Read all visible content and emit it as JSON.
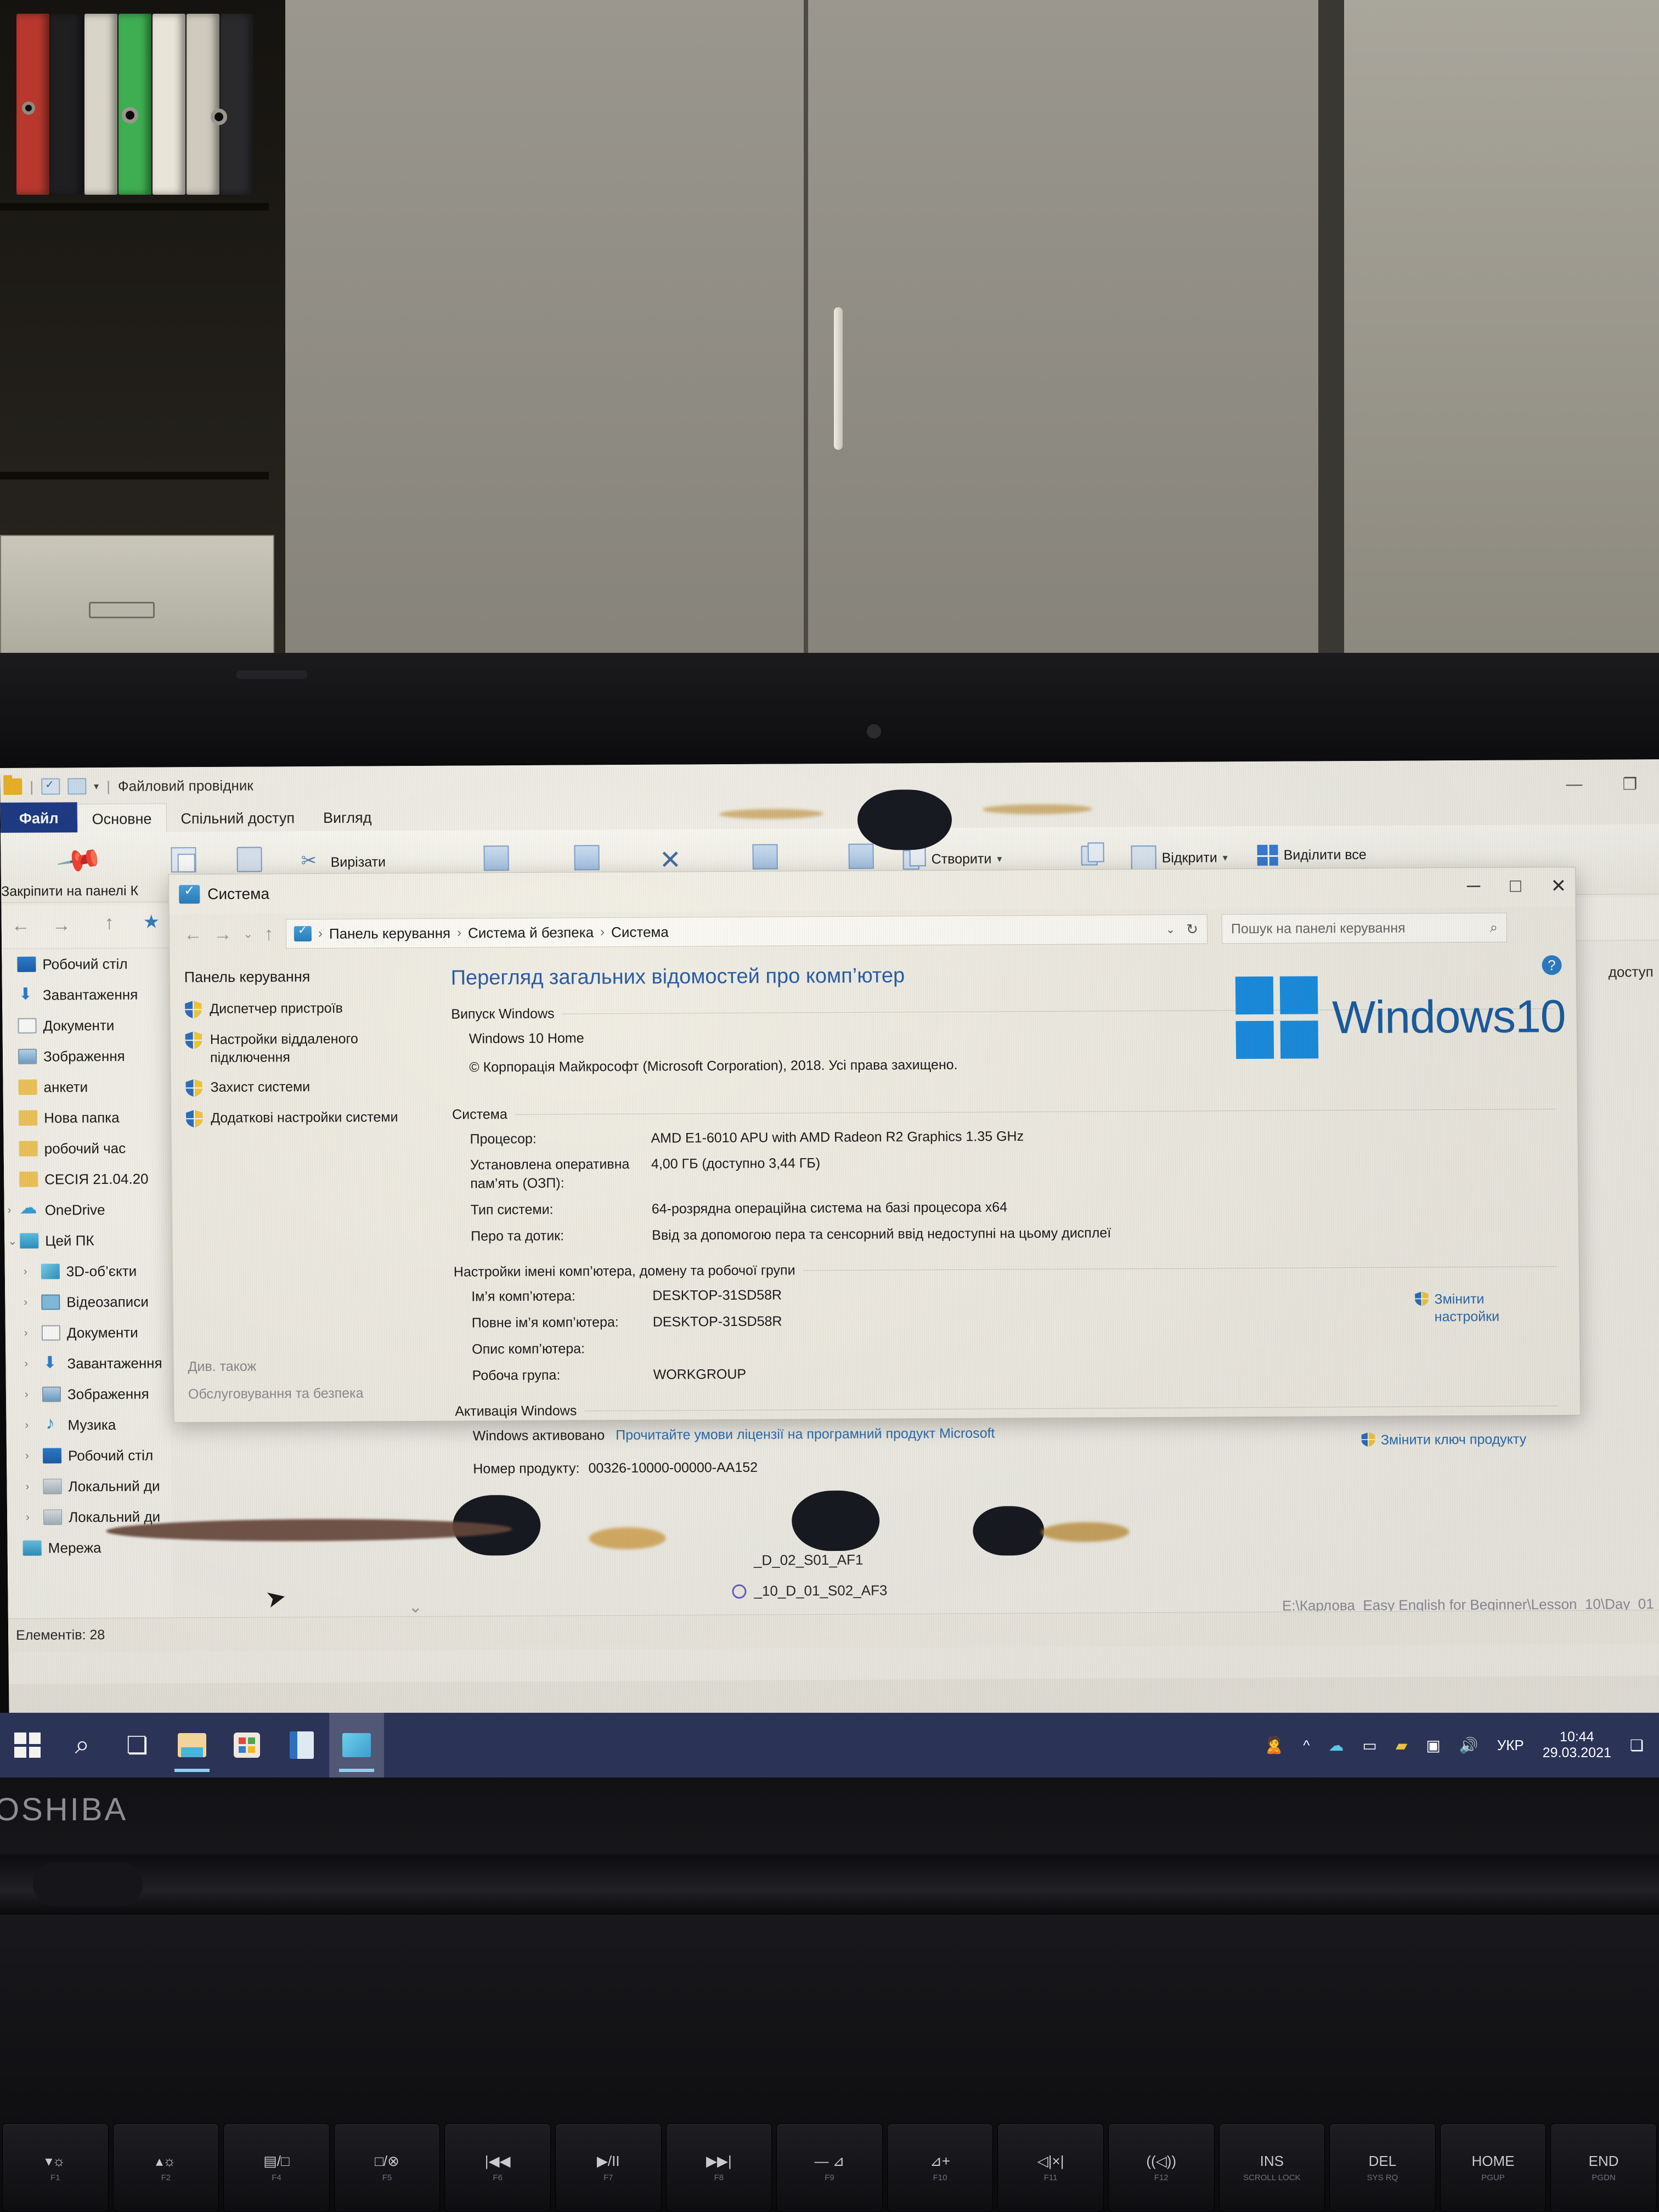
{
  "explorer": {
    "window_title": "Файловий провідник",
    "qat_icons": [
      "folder-icon",
      "properties-icon",
      "new-folder-icon",
      "dropdown-caret-icon"
    ],
    "tabs": [
      {
        "label": "Файл"
      },
      {
        "label": "Основне"
      },
      {
        "label": "Спільний доступ"
      },
      {
        "label": "Вигляд"
      }
    ],
    "ribbon": {
      "pin_label": "Закріпити на панелі К\nшвидкого доступу",
      "cut_label": "Вирізати",
      "new_label": "Створити",
      "open_label": "Відкрити",
      "select_all_label": "Виділити все"
    },
    "quick_access": [
      {
        "label": "Робочий стіл",
        "icon": "desktop-icon"
      },
      {
        "label": "Завантаження",
        "icon": "downloads-icon"
      },
      {
        "label": "Документи",
        "icon": "documents-icon"
      },
      {
        "label": "Зображення",
        "icon": "pictures-icon"
      },
      {
        "label": "анкети",
        "icon": "folder-icon"
      },
      {
        "label": "Нова папка",
        "icon": "folder-icon"
      },
      {
        "label": "робочий час",
        "icon": "folder-icon"
      },
      {
        "label": "СЕСІЯ 21.04.20",
        "icon": "folder-icon"
      }
    ],
    "onedrive": {
      "label": "OneDrive",
      "icon": "cloud-icon"
    },
    "this_pc": {
      "label": "Цей ПК",
      "icon": "pc-icon"
    },
    "this_pc_children": [
      {
        "label": "3D-об’єкти",
        "icon": "3d-objects-icon"
      },
      {
        "label": "Відеозаписи",
        "icon": "videos-icon"
      },
      {
        "label": "Документи",
        "icon": "documents-icon"
      },
      {
        "label": "Завантаження",
        "icon": "downloads-icon"
      },
      {
        "label": "Зображення",
        "icon": "pictures-icon"
      },
      {
        "label": "Музика",
        "icon": "music-icon"
      },
      {
        "label": "Робочий стіл",
        "icon": "desktop-icon"
      },
      {
        "label": "Локальний ди",
        "icon": "drive-icon"
      },
      {
        "label": "Локальний ди",
        "icon": "drive-icon"
      }
    ],
    "network": {
      "label": "Мережа",
      "icon": "network-icon"
    },
    "status": "Елементів: 28",
    "files": [
      {
        "name": "_D_02_S01_AF1"
      },
      {
        "name": "_10_D_01_S02_AF3"
      }
    ],
    "path_text": "E:\\Карлова_Easy English for Beginner\\Lesson_10\\Day_01",
    "right_panel_text": "доступ"
  },
  "system_window": {
    "title": "Система",
    "icon": "system-icon",
    "controls": {
      "minimize": "─",
      "maximize": "□",
      "close": "✕"
    },
    "breadcrumb": [
      "Панель керування",
      "Система й безпека",
      "Система"
    ],
    "search_placeholder": "Пошук на панелі керування",
    "search_icon": "search-icon",
    "refresh_icon": "refresh-icon",
    "help_icon": "help-icon",
    "left_panel": {
      "header": "Панель керування",
      "links": [
        {
          "label": "Диспетчер пристроїв",
          "icon": "shield-icon"
        },
        {
          "label": "Настройки віддаленого підключення",
          "icon": "shield-icon"
        },
        {
          "label": "Захист системи",
          "icon": "shield-icon"
        },
        {
          "label": "Додаткові настройки системи",
          "icon": "shield-icon"
        }
      ],
      "see_also_header": "Див. також",
      "see_also_link": "Обслуговування та безпека"
    },
    "page_title": "Перегляд загальних відомостей про комп’ютер",
    "groups": {
      "windows_edition": {
        "header": "Випуск Windows",
        "edition": "Windows 10 Home",
        "copyright": "© Корпорація Майкрософт (Microsoft Corporation), 2018. Усі права захищено.",
        "logo_text": "Windows",
        "logo_version": "10"
      },
      "system": {
        "header": "Система",
        "rows": [
          {
            "key": "Процесор:",
            "value": "AMD E1-6010 APU with AMD Radeon R2 Graphics      1.35 GHz"
          },
          {
            "key": "Установлена оперативна пам’ять (ОЗП):",
            "value": "4,00 ГБ (доступно 3,44 ГБ)"
          },
          {
            "key": "Тип системи:",
            "value": "64-розрядна операційна система на базі процесора x64"
          },
          {
            "key": "Перо та дотик:",
            "value": "Ввід за допомогою пера та сенсорний ввід недоступні на цьому дисплеї"
          }
        ]
      },
      "computer_name": {
        "header": "Настройки імені комп’ютера, домену та робочої групи",
        "rows": [
          {
            "key": "Ім’я комп’ютера:",
            "value": "DESKTOP-31SD58R"
          },
          {
            "key": "Повне ім’я комп’ютера:",
            "value": "DESKTOP-31SD58R"
          },
          {
            "key": "Опис комп’ютера:",
            "value": ""
          },
          {
            "key": "Робоча група:",
            "value": "WORKGROUP"
          }
        ],
        "change_settings_link": "Змінити настройки"
      },
      "activation": {
        "header": "Активація Windows",
        "status": "Windows активовано",
        "license_link": "Прочитайте умови ліцензії на програмний продукт Microsoft",
        "product_id_key": "Номер продукту:",
        "product_id_value": "00326-10000-00000-AA152",
        "change_key_link": "Змінити ключ продукту"
      }
    }
  },
  "taskbar": {
    "items": [
      {
        "name": "start-button",
        "icon": "windows-logo-icon"
      },
      {
        "name": "search-button",
        "icon": "search-icon"
      },
      {
        "name": "task-view-button",
        "icon": "task-view-icon"
      },
      {
        "name": "file-explorer-button",
        "icon": "folder-icon"
      },
      {
        "name": "microsoft-store-button",
        "icon": "store-icon"
      },
      {
        "name": "excel-button",
        "icon": "excel-icon"
      },
      {
        "name": "control-panel-button",
        "icon": "system-icon"
      }
    ],
    "tray": {
      "people_icon": "people-icon",
      "overflow_icon": "chevron-up-icon",
      "onedrive_icon": "onedrive-icon",
      "battery_icon": "battery-icon",
      "network_icon": "wifi-warning-icon",
      "action_center_icon": "action-center-icon",
      "volume_icon": "volume-icon",
      "language": "УКР",
      "time": "10:44",
      "date": "29.03.2021"
    }
  },
  "laptop": {
    "brand": "OSHIBA",
    "function_keys": [
      {
        "label": "▾☼",
        "sub": "F1"
      },
      {
        "label": "▴☼",
        "sub": "F2"
      },
      {
        "label": "▤/□",
        "sub": "F4"
      },
      {
        "label": "□/⊗",
        "sub": "F5"
      },
      {
        "label": "|◀◀",
        "sub": "F6"
      },
      {
        "label": "▶/II",
        "sub": "F7"
      },
      {
        "label": "▶▶|",
        "sub": "F8"
      },
      {
        "label": "— ⊿",
        "sub": "F9"
      },
      {
        "label": "⊿+",
        "sub": "F10"
      },
      {
        "label": "◁|×|",
        "sub": "F11"
      },
      {
        "label": "((◁))",
        "sub": "F12"
      },
      {
        "label": "INS",
        "sub": "SCROLL LOCK"
      },
      {
        "label": "DEL",
        "sub": "SYS RQ"
      },
      {
        "label": "HOME",
        "sub": "PGUP"
      },
      {
        "label": "END",
        "sub": "PGDN"
      }
    ]
  }
}
